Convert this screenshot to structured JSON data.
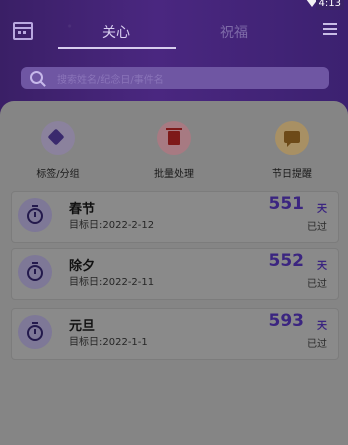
{
  "status_bar": {
    "time": "4:13"
  },
  "header": {
    "tabs": [
      {
        "label": "关心",
        "active": true
      },
      {
        "label": "祝福",
        "active": false
      }
    ]
  },
  "search": {
    "placeholder": "搜索姓名/纪念日/事件名"
  },
  "toolbar": {
    "items": [
      {
        "label": "标签/分组",
        "icon": "tag-icon"
      },
      {
        "label": "批量处理",
        "icon": "trash-icon"
      },
      {
        "label": "节日提醒",
        "icon": "message-icon"
      }
    ]
  },
  "events": [
    {
      "name": "春节",
      "date": "目标日:2022-2-12",
      "days": "551",
      "unit": "天",
      "status": "已过"
    },
    {
      "name": "除夕",
      "date": "目标日:2022-2-11",
      "days": "552",
      "unit": "天",
      "status": "已过"
    },
    {
      "name": "元旦",
      "date": "目标日:2022-1-1",
      "days": "593",
      "unit": "天",
      "status": "已过"
    }
  ],
  "colors": {
    "header": "#3a1f66",
    "accent": "#3b2580",
    "overlay": "#858585"
  }
}
